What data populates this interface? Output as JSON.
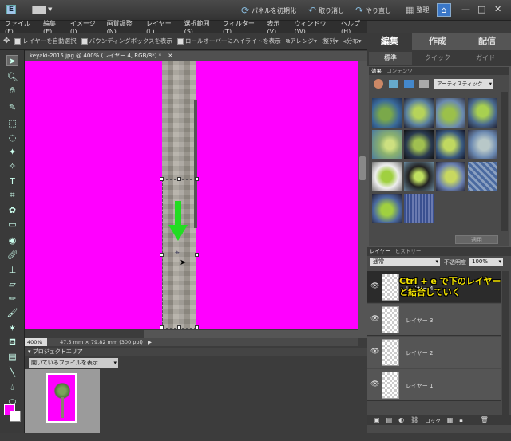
{
  "topbar": {
    "reset_panels": "パネルを初期化",
    "undo": "取り消し",
    "redo": "やり直し",
    "organize": "整理"
  },
  "menu": [
    "ファイル(F)",
    "編集(E)",
    "イメージ(I)",
    "画質調整(N)",
    "レイヤー(L)",
    "選択範囲(S)",
    "フィルター(T)",
    "表示(V)",
    "ウィンドウ(W)",
    "ヘルプ(H)"
  ],
  "options": {
    "auto_select": "レイヤーを自動選択",
    "bounding_box": "バウンディングボックスを表示",
    "rollover": "ロールオーバーにハイライトを表示",
    "arrange": "アレンジ",
    "align": "整列",
    "distribute": "分布"
  },
  "document": {
    "tab": "keyaki-2015.jpg @ 400% (レイヤー 4, RGB/8*) *",
    "zoom": "400%",
    "dimensions": "47.5 mm × 79.82 mm (300 ppi)"
  },
  "project": {
    "title": "プロジェクトエリア",
    "filter": "開いているファイルを表示"
  },
  "modes": {
    "edit": "編集",
    "create": "作成",
    "share": "配信"
  },
  "subtabs": {
    "standard": "標準",
    "quick": "クイック",
    "guide": "ガイド"
  },
  "effects": {
    "tabs": [
      "効果",
      "コンテンツ"
    ],
    "dropdown": "アーティスティック",
    "apply": "適用"
  },
  "layers": {
    "tabs": [
      "レイヤー",
      "ヒストリー"
    ],
    "blend": "通常",
    "opacity_label": "不透明度",
    "opacity": "100%",
    "items": [
      "レイヤー 4",
      "レイヤー 3",
      "レイヤー 2",
      "レイヤー 1"
    ],
    "bottom": [
      "ロック"
    ]
  },
  "annotation": "Ctrl + e で下のレイヤーと結合していく",
  "colors": {
    "canvas": "#ff00ff",
    "arrow": "#22dd22",
    "annotation": "#f0e000"
  }
}
